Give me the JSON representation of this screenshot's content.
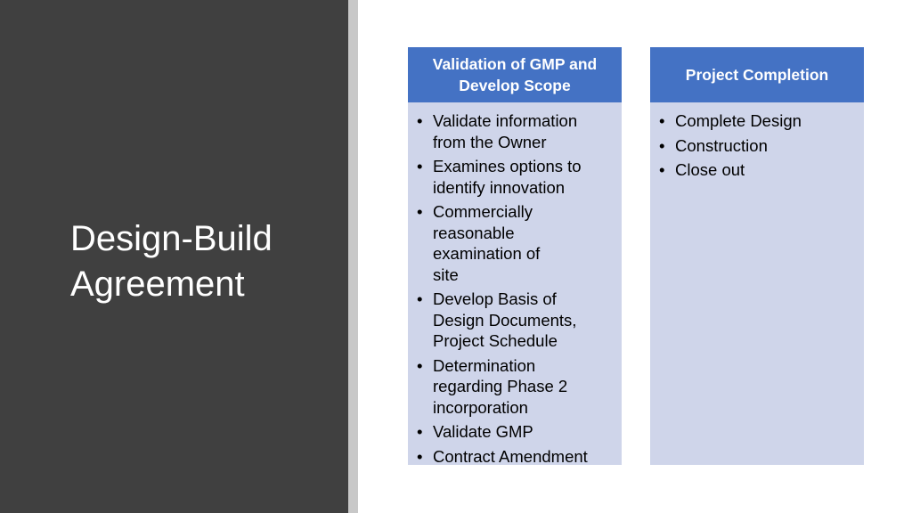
{
  "slide": {
    "title_line1": "Design-Build",
    "title_line2": "Agreement"
  },
  "columns": [
    {
      "header": "Validation of GMP and Develop Scope",
      "items": [
        "Validate information from the Owner",
        "Examines options to identify innovation",
        "Commercially reasonable examination of site",
        "Develop Basis of Design Documents, Project Schedule",
        "Determination regarding Phase 2 incorporation",
        "Validate GMP",
        "Contract Amendment"
      ]
    },
    {
      "header": "Project Completion",
      "items": [
        "Complete Design",
        "Construction",
        "Close out"
      ]
    }
  ],
  "bullet_glyph": "•",
  "colors": {
    "left_panel": "#404040",
    "divider": "#c8c8c8",
    "header": "#4472c4",
    "body": "#cfd5ea"
  }
}
